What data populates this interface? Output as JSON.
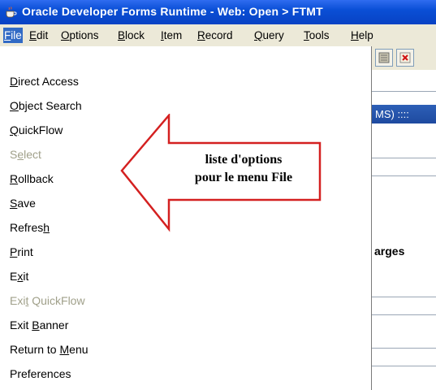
{
  "window": {
    "title": "Oracle Developer Forms Runtime - Web:  Open > FTMT",
    "icon": "java-cup-icon"
  },
  "menubar": {
    "items": [
      {
        "pre": "",
        "mn": "F",
        "post": "ile",
        "active": true
      },
      {
        "pre": "",
        "mn": "E",
        "post": "dit"
      },
      {
        "pre": "",
        "mn": "O",
        "post": "ptions"
      },
      {
        "pre": "",
        "mn": "B",
        "post": "lock"
      },
      {
        "pre": "",
        "mn": "I",
        "post": "tem"
      },
      {
        "pre": "",
        "mn": "R",
        "post": "ecord"
      },
      {
        "pre": "",
        "mn": "Q",
        "post": "uery"
      },
      {
        "pre": "",
        "mn": "T",
        "post": "ools"
      },
      {
        "pre": "",
        "mn": "H",
        "post": "elp"
      }
    ]
  },
  "file_menu": {
    "items": [
      {
        "pre": "",
        "mn": "D",
        "post": "irect Access",
        "enabled": true
      },
      {
        "pre": "",
        "mn": "O",
        "post": "bject Search",
        "enabled": true
      },
      {
        "pre": "",
        "mn": "Q",
        "post": "uickFlow",
        "enabled": true
      },
      {
        "pre": "S",
        "mn": "e",
        "post": "lect",
        "enabled": false
      },
      {
        "pre": "",
        "mn": "R",
        "post": "ollback",
        "enabled": true
      },
      {
        "pre": "",
        "mn": "S",
        "post": "ave",
        "enabled": true
      },
      {
        "pre": "Refres",
        "mn": "h",
        "post": "",
        "enabled": true
      },
      {
        "pre": "",
        "mn": "P",
        "post": "rint",
        "enabled": true
      },
      {
        "pre": "E",
        "mn": "x",
        "post": "it",
        "enabled": true
      },
      {
        "pre": "Exi",
        "mn": "t",
        "post": " QuickFlow",
        "enabled": false
      },
      {
        "pre": "Exit ",
        "mn": "B",
        "post": "anner",
        "enabled": true
      },
      {
        "pre": "Return to ",
        "mn": "M",
        "post": "enu",
        "enabled": true
      },
      {
        "pre": "Preferences",
        "mn": "",
        "post": "",
        "enabled": true
      }
    ]
  },
  "callout": {
    "line1": "liste d'options",
    "line2": "pour le menu File",
    "fill": "#ffffff",
    "stroke": "#d42020"
  },
  "background": {
    "blue_strip_text": "MS) ::::",
    "field_label": "arges",
    "toolbar_icons": [
      "database-icon",
      "close-red-icon"
    ]
  },
  "colors": {
    "title_bar": "#0a4fd6",
    "menu_bar": "#ece9d8",
    "menu_highlight": "#316ac5",
    "disabled_text": "#a0a08a"
  }
}
